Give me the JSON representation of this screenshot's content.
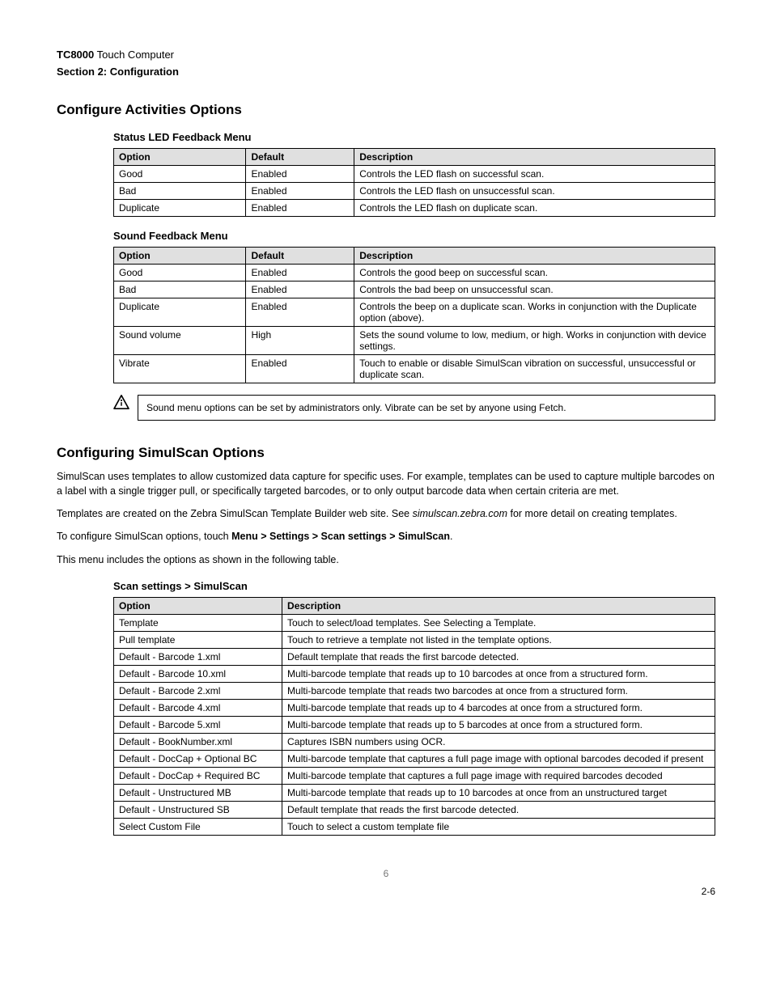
{
  "header": {
    "model": "TC8000",
    "suffix": " Touch Computer",
    "section": "Section 2: Configuration"
  },
  "section_title": "Configure Activities Options",
  "table1": {
    "caption": "Status LED Feedback Menu",
    "headers": [
      "Option",
      "Default",
      "Description"
    ],
    "rows": [
      [
        "Good",
        "Enabled",
        "Controls the LED flash on successful scan."
      ],
      [
        "Bad",
        "Enabled",
        "Controls the LED flash on unsuccessful scan."
      ],
      [
        "Duplicate",
        "Enabled",
        "Controls the LED flash on duplicate scan."
      ]
    ]
  },
  "table2": {
    "caption": "Sound Feedback Menu",
    "headers": [
      "Option",
      "Default",
      "Description"
    ],
    "rows": [
      [
        "Good",
        "Enabled",
        "Controls the good beep on successful scan."
      ],
      [
        "Bad",
        "Enabled",
        "Controls the bad beep on unsuccessful scan."
      ],
      [
        "Duplicate",
        "Enabled",
        "Controls the beep on a duplicate scan.  Works in conjunction with the Duplicate option (above)."
      ],
      [
        "Sound volume",
        "High",
        "Sets the sound volume to low, medium, or high.  Works in conjunction with device settings."
      ],
      [
        "Vibrate",
        "Enabled",
        "Touch to enable or disable SimulScan vibration on successful, unsuccessful or duplicate scan."
      ]
    ]
  },
  "notice": {
    "text": "Sound menu options can be set by administrators only.  Vibrate can be set by anyone using Fetch."
  },
  "config_title": "Configuring SimulScan Options",
  "para1": "SimulScan uses templates to allow customized data capture for specific uses. For example, templates can be used to capture multiple barcodes on a label with a single trigger pull, or specifically targeted barcodes, or to only output barcode data when certain criteria are met.",
  "para2_pre": "Templates are created on the Zebra SimulScan Template Builder web site. See ",
  "para2_link": "simulscan.zebra.com",
  "para2_post": " for more detail on creating templates.",
  "para3_pre": "To configure SimulScan options, touch ",
  "para3_menu": "Menu > Settings > Scan settings > SimulScan",
  "para3_post": ".",
  "para4": "This menu includes the options as shown in the following table.",
  "table3": {
    "caption": "Scan settings > SimulScan",
    "headers": [
      "Option",
      "Description"
    ],
    "rows": [
      [
        "Template",
        "Touch to select/load templates. See Selecting a Template."
      ],
      [
        "Pull template",
        "Touch to retrieve a template not listed in the template options."
      ],
      [
        "Default - Barcode 1.xml",
        "Default template that reads the first barcode detected."
      ],
      [
        "Default - Barcode 10.xml",
        "Multi-barcode template that reads up to 10 barcodes at once from a structured form."
      ],
      [
        "Default - Barcode 2.xml",
        "Multi-barcode template that reads two barcodes at once from a structured form."
      ],
      [
        "Default - Barcode 4.xml",
        "Multi-barcode template that reads up to 4 barcodes at once from a structured form."
      ],
      [
        "Default - Barcode 5.xml",
        "Multi-barcode template that reads up to 5 barcodes at once from a structured form."
      ],
      [
        "Default - BookNumber.xml",
        "Captures ISBN numbers using OCR."
      ],
      [
        "Default - DocCap + Optional BC",
        "Multi-barcode template that captures a full page image with optional barcodes decoded if present"
      ],
      [
        "Default - DocCap + Required BC",
        "Multi-barcode template that captures a full page image with required barcodes decoded"
      ],
      [
        "Default - Unstructured MB",
        "Multi-barcode template that reads up to 10 barcodes at once from an unstructured target"
      ],
      [
        "Default - Unstructured SB",
        "Default template that reads the first barcode detected."
      ],
      [
        "Select Custom File",
        "Touch to select a custom template file"
      ]
    ]
  },
  "footer": {
    "center_page": "6",
    "right_page": "2-6"
  }
}
